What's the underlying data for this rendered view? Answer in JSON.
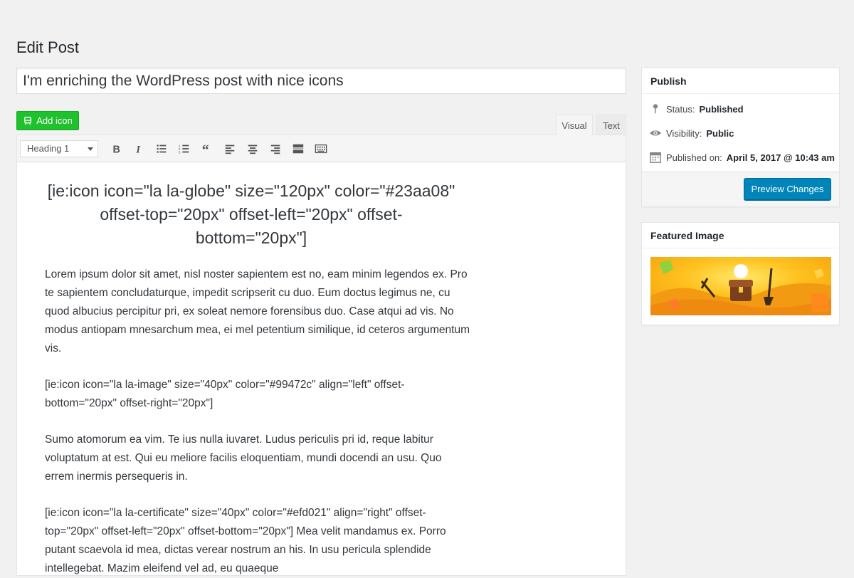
{
  "page": {
    "title": "Edit Post"
  },
  "post": {
    "title": "I'm enriching the WordPress post with nice icons"
  },
  "editor": {
    "add_icon_label": "Add icon",
    "tabs": [
      {
        "label": "Visual"
      },
      {
        "label": "Text"
      }
    ],
    "format_select": "Heading 1",
    "toolbar_icons": [
      "bold-icon",
      "italic-icon",
      "bullet-list-icon",
      "numbered-list-icon",
      "blockquote-icon",
      "align-left-icon",
      "align-center-icon",
      "align-right-icon",
      "read-more-icon",
      "toolbar-toggle-icon"
    ],
    "heading": "[ie:icon icon=\"la la-globe\" size=\"120px\" color=\"#23aa08\" offset-top=\"20px\" offset-left=\"20px\" offset-bottom=\"20px\"]",
    "paragraphs": [
      "Lorem ipsum dolor sit amet, nisl noster sapientem est no, eam minim legendos ex. Pro te sapientem concludaturque, impedit scripserit cu duo. Eum doctus legimus ne, cu quod albucius percipitur pri, ex soleat nemore forensibus duo. Case atqui ad vis. No modus antiopam mnesarchum mea, ei mel petentium similique, id ceteros argumentum vis.",
      "[ie:icon icon=\"la la-image\" size=\"40px\" color=\"#99472c\" align=\"left\" offset-bottom=\"20px\" offset-right=\"20px\"]",
      "Sumo atomorum ea vim. Te ius nulla iuvaret. Ludus periculis pri id, reque labitur voluptatum at est. Qui eu meliore facilis eloquentiam, mundi docendi an usu. Quo errem inermis persequeris in.",
      "[ie:icon icon=\"la la-certificate\" size=\"40px\" color=\"#efd021\" align=\"right\" offset-top=\"20px\" offset-left=\"20px\" offset-bottom=\"20px\"] Mea velit mandamus ex. Porro putant scaevola id mea, dictas verear nostrum an his. In usu pericula splendide intellegebat. Mazim eleifend vel ad, eu quaeque"
    ]
  },
  "publish": {
    "title": "Publish",
    "status_label": "Status:",
    "status_value": "Published",
    "visibility_label": "Visibility:",
    "visibility_value": "Public",
    "published_label": "Published on:",
    "published_value": "April 5, 2017 @ 10:43 am",
    "preview_label": "Preview Changes"
  },
  "featured": {
    "title": "Featured Image"
  },
  "colors": {
    "add_icon": "#1fc12c",
    "primary": "#0085ba",
    "background": "#f1f1f1"
  }
}
